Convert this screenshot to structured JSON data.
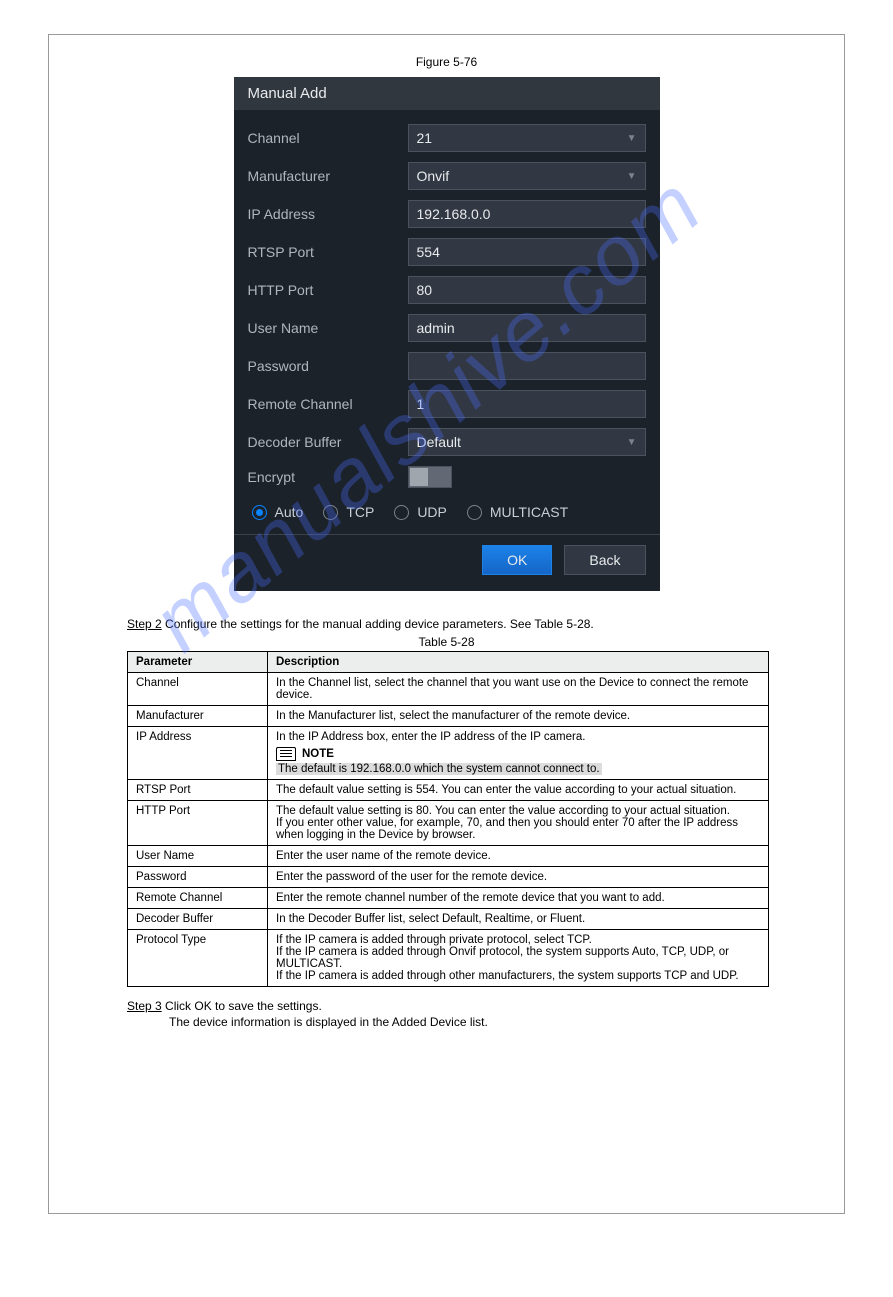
{
  "figure_label": "Figure 5-76",
  "dialog": {
    "title": "Manual Add",
    "rows": {
      "channel_label": "Channel",
      "channel_value": "21",
      "manufacturer_label": "Manufacturer",
      "manufacturer_value": "Onvif",
      "ip_label": "IP Address",
      "ip_value": "192.168.0.0",
      "rtsp_label": "RTSP Port",
      "rtsp_value": "554",
      "http_label": "HTTP Port",
      "http_value": "80",
      "user_label": "User Name",
      "user_value": "admin",
      "pass_label": "Password",
      "pass_value": "",
      "remote_label": "Remote Channel",
      "remote_value": "1",
      "decoder_label": "Decoder Buffer",
      "decoder_value": "Default",
      "encrypt_label": "Encrypt"
    },
    "radios": {
      "auto": "Auto",
      "tcp": "TCP",
      "udp": "UDP",
      "multicast": "MULTICAST"
    },
    "ok": "OK",
    "back": "Back"
  },
  "step2_prefix": "Step 2",
  "step2_text": "Configure the settings for the manual adding device parameters. See Table 5-28.",
  "table_caption": "Table 5-28",
  "table": {
    "h_param": "Parameter",
    "h_desc": "Description",
    "rows": [
      {
        "param": "Channel",
        "desc": "In the Channel list, select the channel that you want use on the Device to connect the remote device."
      },
      {
        "param": "Manufacturer",
        "desc": "In the Manufacturer list, select the manufacturer of the remote device."
      },
      {
        "param": "IP Address",
        "desc_line1": "In the IP Address box, enter the IP address of the IP camera.",
        "note_label": "NOTE",
        "note_text": "The default is 192.168.0.0 which the system cannot connect to."
      },
      {
        "param": "RTSP Port",
        "desc": "The default value setting is 554. You can enter the value according to your actual situation."
      },
      {
        "param": "HTTP Port",
        "desc": "The default value setting is 80. You can enter the value according to your actual situation.\nIf you enter other value, for example, 70, and then you should enter 70 after the IP address when logging in the Device by browser."
      },
      {
        "param": "User Name",
        "desc": "Enter the user name of the remote device."
      },
      {
        "param": "Password",
        "desc": "Enter the password of the user for the remote device."
      },
      {
        "param": "Remote Channel",
        "desc": "Enter the remote channel number of the remote device that you want to add."
      },
      {
        "param": "Decoder Buffer",
        "desc": "In the Decoder Buffer list, select Default, Realtime, or Fluent."
      },
      {
        "param": "Protocol Type",
        "desc": "If the IP camera is added through private protocol, select TCP.\nIf the IP camera is added through Onvif protocol, the system supports Auto, TCP, UDP, or MULTICAST.\nIf the IP camera is added through other manufacturers, the system supports TCP and UDP."
      }
    ]
  },
  "step3_prefix": "Step 3",
  "step3_text": "Click OK to save the settings.",
  "step3_sub": "The device information is displayed in the Added Device list.",
  "watermark": "manualshive.com"
}
